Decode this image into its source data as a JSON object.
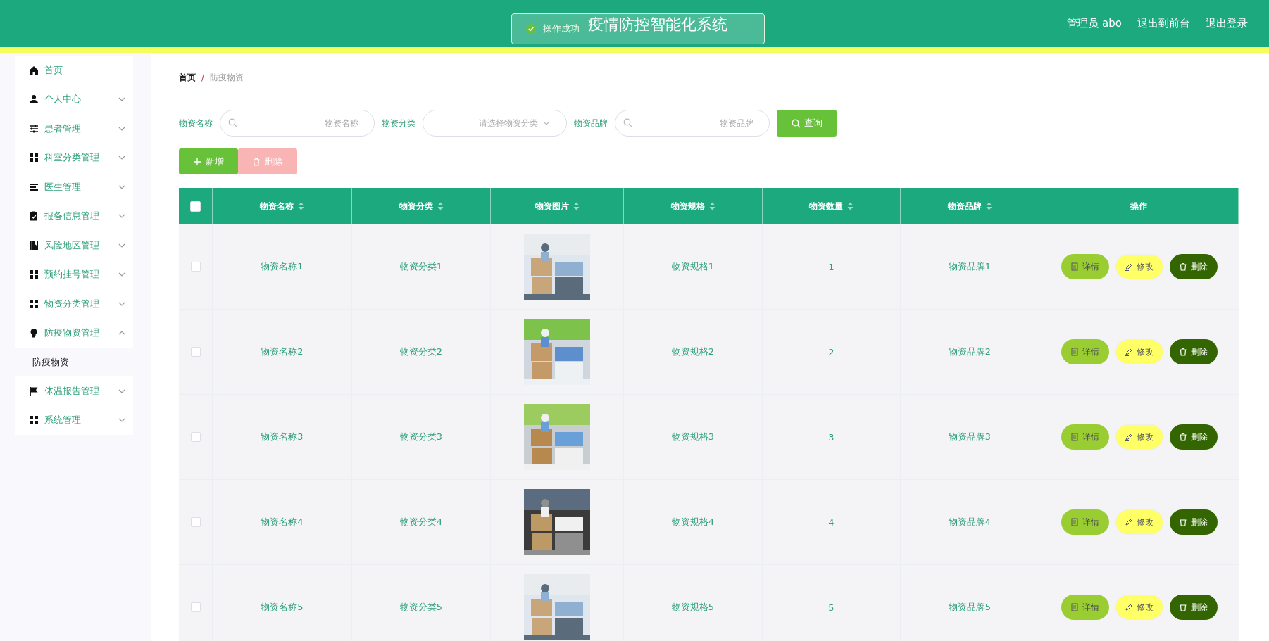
{
  "header": {
    "title": "疫情防控智能化系统",
    "links": [
      "管理员 abo",
      "退出到前台",
      "退出登录"
    ]
  },
  "toast": {
    "message": "操作成功"
  },
  "sidebar": {
    "items": [
      {
        "label": "首页",
        "expandable": false
      },
      {
        "label": "个人中心",
        "expandable": true,
        "expanded": false
      },
      {
        "label": "患者管理",
        "expandable": true,
        "expanded": false
      },
      {
        "label": "科室分类管理",
        "expandable": true,
        "expanded": false
      },
      {
        "label": "医生管理",
        "expandable": true,
        "expanded": false
      },
      {
        "label": "报备信息管理",
        "expandable": true,
        "expanded": false
      },
      {
        "label": "风险地区管理",
        "expandable": true,
        "expanded": false
      },
      {
        "label": "预约挂号管理",
        "expandable": true,
        "expanded": false
      },
      {
        "label": "物资分类管理",
        "expandable": true,
        "expanded": false
      },
      {
        "label": "防疫物资管理",
        "expandable": true,
        "expanded": true,
        "children": [
          {
            "label": "防疫物资",
            "selected": true
          }
        ]
      },
      {
        "label": "体温报告管理",
        "expandable": true,
        "expanded": false
      },
      {
        "label": "系统管理",
        "expandable": true,
        "expanded": false
      }
    ]
  },
  "breadcrumb": {
    "items": [
      "首页",
      "防疫物资"
    ],
    "separator": "/"
  },
  "search": {
    "fields": [
      {
        "kind": "input",
        "label": "物资名称",
        "placeholder": "物资名称"
      },
      {
        "kind": "select",
        "label": "物资分类",
        "placeholder": "请选择物资分类"
      },
      {
        "kind": "input",
        "label": "物资品牌",
        "placeholder": "物资品牌"
      }
    ],
    "button": "查询"
  },
  "actions": [
    {
      "label": "新增",
      "kind": "add",
      "disabled": false
    },
    {
      "label": "删除",
      "kind": "delete",
      "disabled": true
    }
  ],
  "table": {
    "select_all": false,
    "columns": [
      {
        "label": "物资名称",
        "sortable": true
      },
      {
        "label": "物资分类",
        "sortable": true
      },
      {
        "label": "物资图片",
        "sortable": true
      },
      {
        "label": "物资规格",
        "sortable": true
      },
      {
        "label": "物资数量",
        "sortable": true
      },
      {
        "label": "物资品牌",
        "sortable": true
      },
      {
        "label": "操作",
        "sortable": false
      }
    ],
    "rows": [
      {
        "checked": false,
        "cells": [
          "物资名称1",
          "物资分类1",
          {
            "kind": "picture"
          },
          "物资规格1",
          "1",
          "物资品牌1"
        ],
        "actions": [
          {
            "label": "详情",
            "kind": "detail"
          },
          {
            "label": "修改",
            "kind": "edit"
          },
          {
            "label": "删除",
            "kind": "delete"
          }
        ]
      },
      {
        "checked": false,
        "cells": [
          "物资名称2",
          "物资分类2",
          {
            "kind": "picture"
          },
          "物资规格2",
          "2",
          "物资品牌2"
        ],
        "actions": [
          {
            "label": "详情",
            "kind": "detail"
          },
          {
            "label": "修改",
            "kind": "edit"
          },
          {
            "label": "删除",
            "kind": "delete"
          }
        ]
      },
      {
        "checked": false,
        "cells": [
          "物资名称3",
          "物资分类3",
          {
            "kind": "picture"
          },
          "物资规格3",
          "3",
          "物资品牌3"
        ],
        "actions": [
          {
            "label": "详情",
            "kind": "detail"
          },
          {
            "label": "修改",
            "kind": "edit"
          },
          {
            "label": "删除",
            "kind": "delete"
          }
        ]
      },
      {
        "checked": false,
        "cells": [
          "物资名称4",
          "物资分类4",
          {
            "kind": "picture"
          },
          "物资规格4",
          "4",
          "物资品牌4"
        ],
        "actions": [
          {
            "label": "详情",
            "kind": "detail"
          },
          {
            "label": "修改",
            "kind": "edit"
          },
          {
            "label": "删除",
            "kind": "delete"
          }
        ]
      },
      {
        "checked": false,
        "cells": [
          "物资名称5",
          "物资分类5",
          {
            "kind": "picture"
          },
          "物资规格5",
          "5",
          "物资品牌5"
        ],
        "actions": [
          {
            "label": "详情",
            "kind": "detail"
          },
          {
            "label": "修改",
            "kind": "edit"
          },
          {
            "label": "删除",
            "kind": "delete"
          }
        ]
      }
    ]
  }
}
